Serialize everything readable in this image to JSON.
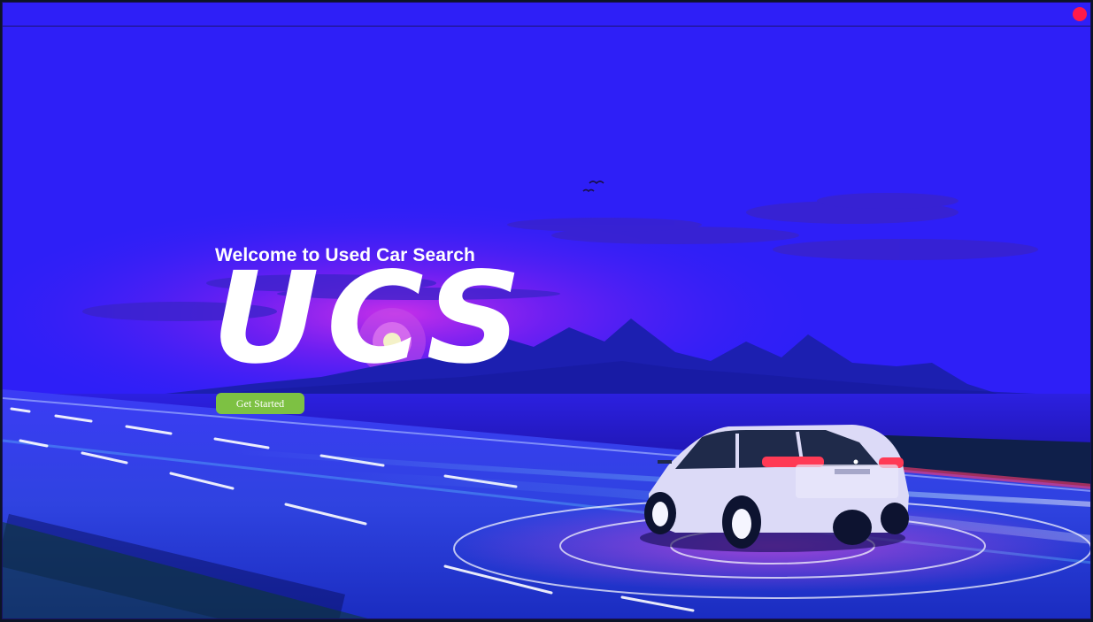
{
  "window": {
    "close_color": "#ff1a4a",
    "title_color": "#2e1ff7"
  },
  "hero": {
    "welcome_text": "Welcome to Used Car Search",
    "logo_text": "UCS",
    "cta_label": "Get Started",
    "cta_color": "#7dc143"
  },
  "icons": {
    "close": "close-icon",
    "birds": "birds-icon"
  }
}
